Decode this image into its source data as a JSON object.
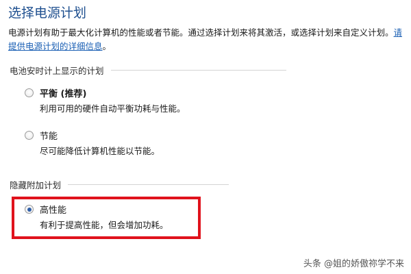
{
  "window": {
    "title": "选择电源计划"
  },
  "intro": {
    "text": "电源计划有助于最大化计算机的性能或者节能。通过选择计划来将其激活，或选择计划来自定义计划。",
    "link_label": "请提供电源计划的详细信息",
    "trailing": "。"
  },
  "battery_section": {
    "label": "电池安时计上显示的计划",
    "plans": [
      {
        "name": "平衡 (推荐)",
        "description": "利用可用的硬件自动平衡功耗与性能。",
        "selected": false
      },
      {
        "name": "节能",
        "description": "尽可能降低计算机性能以节能。",
        "selected": false
      }
    ]
  },
  "hidden_section": {
    "label": "隐藏附加计划",
    "plans": [
      {
        "name": "高性能",
        "description": "有利于提高性能，但会增加功耗。",
        "selected": true
      }
    ]
  },
  "annotation": {
    "highlight_color": "#e0121c"
  },
  "watermark": {
    "text": "头条 @姐的娇傲祢学不来"
  },
  "colors": {
    "title": "#1e4f8f",
    "link": "#1a5fb4",
    "radio_dot": "#2f5fa8"
  }
}
